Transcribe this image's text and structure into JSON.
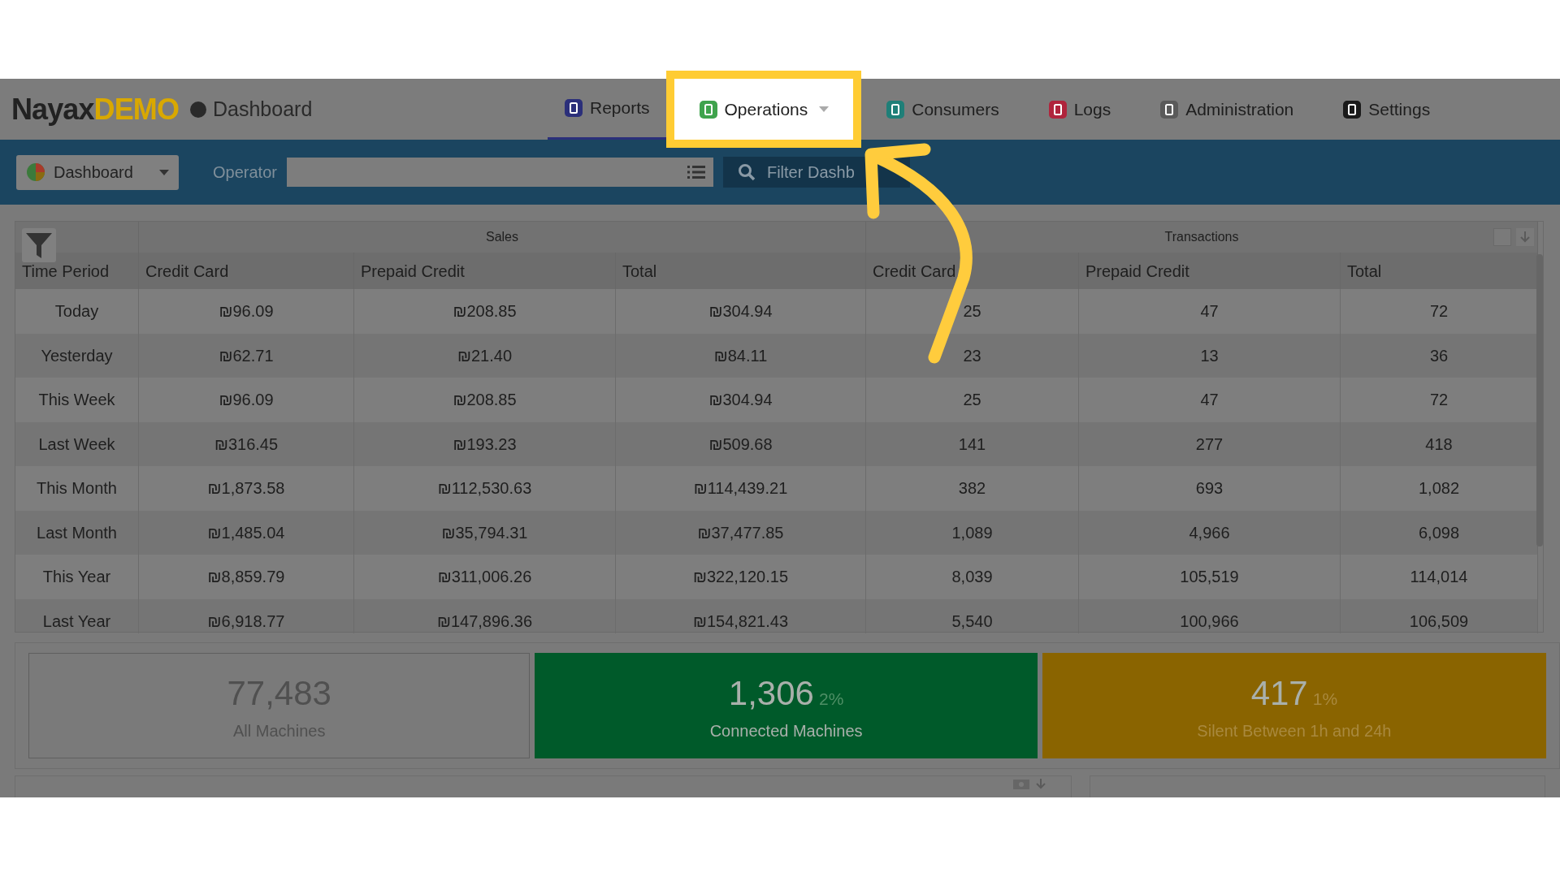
{
  "header": {
    "logo": {
      "name": "Nayax",
      "suffix": "DEMO"
    },
    "breadcrumb": "Dashboard",
    "tabs": [
      {
        "label": "Reports",
        "selected": true,
        "highlighted": false,
        "kind": "plain",
        "color": "#2b2f7a"
      },
      {
        "label": "Operations",
        "selected": false,
        "highlighted": true,
        "kind": "menu",
        "color": "#3fa34d"
      },
      {
        "label": "Consumers",
        "selected": false,
        "highlighted": false,
        "kind": "plain",
        "color": "#1f7f78"
      },
      {
        "label": "Logs",
        "selected": false,
        "highlighted": false,
        "kind": "plain",
        "color": "#b0243c"
      },
      {
        "label": "Administration",
        "selected": false,
        "highlighted": false,
        "kind": "plain",
        "color": "#5a5a5a"
      },
      {
        "label": "Settings",
        "selected": false,
        "highlighted": false,
        "kind": "plain",
        "color": "#1a1a1a"
      }
    ]
  },
  "toolbar": {
    "dashboard_select": "Dashboard",
    "operator_label": "Operator",
    "filter_button": "Filter Dashb"
  },
  "table": {
    "first_column": "Time Period",
    "groups": [
      {
        "label": "Sales",
        "columns": [
          "Credit Card",
          "Prepaid Credit",
          "Total"
        ]
      },
      {
        "label": "Transactions",
        "columns": [
          "Credit Card",
          "Prepaid Credit",
          "Total"
        ]
      }
    ],
    "rows": [
      {
        "period": "Today",
        "values": [
          "₪96.09",
          "₪208.85",
          "₪304.94",
          "25",
          "47",
          "72"
        ]
      },
      {
        "period": "Yesterday",
        "values": [
          "₪62.71",
          "₪21.40",
          "₪84.11",
          "23",
          "13",
          "36"
        ]
      },
      {
        "period": "This Week",
        "values": [
          "₪96.09",
          "₪208.85",
          "₪304.94",
          "25",
          "47",
          "72"
        ]
      },
      {
        "period": "Last Week",
        "values": [
          "₪316.45",
          "₪193.23",
          "₪509.68",
          "141",
          "277",
          "418"
        ]
      },
      {
        "period": "This Month",
        "values": [
          "₪1,873.58",
          "₪112,530.63",
          "₪114,439.21",
          "382",
          "693",
          "1,082"
        ]
      },
      {
        "period": "Last Month",
        "values": [
          "₪1,485.04",
          "₪35,794.31",
          "₪37,477.85",
          "1,089",
          "4,966",
          "6,098"
        ]
      },
      {
        "period": "This Year",
        "values": [
          "₪8,859.79",
          "₪311,006.26",
          "₪322,120.15",
          "8,039",
          "105,519",
          "114,014"
        ]
      },
      {
        "period": "Last Year",
        "values": [
          "₪6,918.77",
          "₪147,896.36",
          "₪154,821.43",
          "5,540",
          "100,966",
          "106,509"
        ]
      }
    ]
  },
  "cards": [
    {
      "value": "77,483",
      "label": "All Machines",
      "color": "#7a7a7a"
    },
    {
      "value": "1,306",
      "percent": "2%",
      "label": "Connected Machines",
      "color": "#005a2a"
    },
    {
      "value": "417",
      "percent": "1%",
      "label": "Silent Between 1h and 24h",
      "color": "#8a6400"
    }
  ]
}
